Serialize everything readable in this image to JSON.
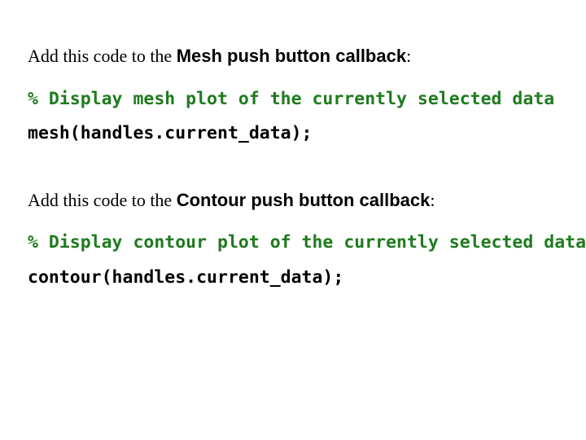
{
  "block1": {
    "intro_prefix": "Add this code to the ",
    "intro_bold": "Mesh push button callback",
    "intro_suffix": ":",
    "comment": "% Display mesh plot of the currently selected data",
    "statement": "mesh(handles.current_data);"
  },
  "block2": {
    "intro_prefix": "Add this code to the ",
    "intro_bold": "Contour push button callback",
    "intro_suffix": ":",
    "comment": "% Display contour plot of the currently selected data",
    "statement": "contour(handles.current_data);"
  }
}
